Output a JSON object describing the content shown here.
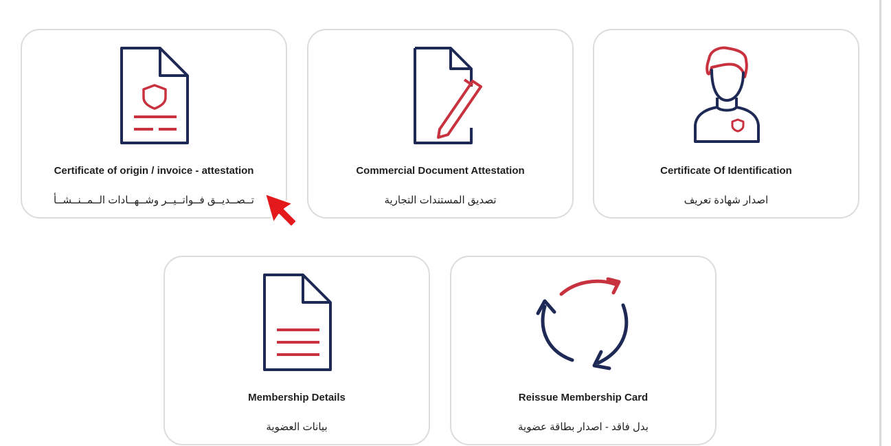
{
  "colors": {
    "navy": "#1e2a55",
    "red": "#c8323f",
    "card_border": "#dcdcdc",
    "cursor": "#e3191c"
  },
  "cards": [
    {
      "icon": "certificate-document-icon",
      "title": "Certificate of origin / invoice - attestation",
      "subtitle": "تــصــديــق فــواتــيــر وشــهــادات الــمــنــشــأ"
    },
    {
      "icon": "document-pen-icon",
      "title": "Commercial Document Attestation",
      "subtitle": "تصديق المستندات التجارية"
    },
    {
      "icon": "person-id-icon",
      "title": "Certificate Of Identification",
      "subtitle": "اصدار شهادة تعريف"
    },
    {
      "icon": "document-lines-icon",
      "title": "Membership Details",
      "subtitle": "بيانات العضوية"
    },
    {
      "icon": "reissue-cycle-icon",
      "title": "Reissue Membership Card",
      "subtitle": "بدل فاقد - اصدار بطاقة عضوية"
    }
  ],
  "cursor_icon": "pointer-arrow-icon"
}
